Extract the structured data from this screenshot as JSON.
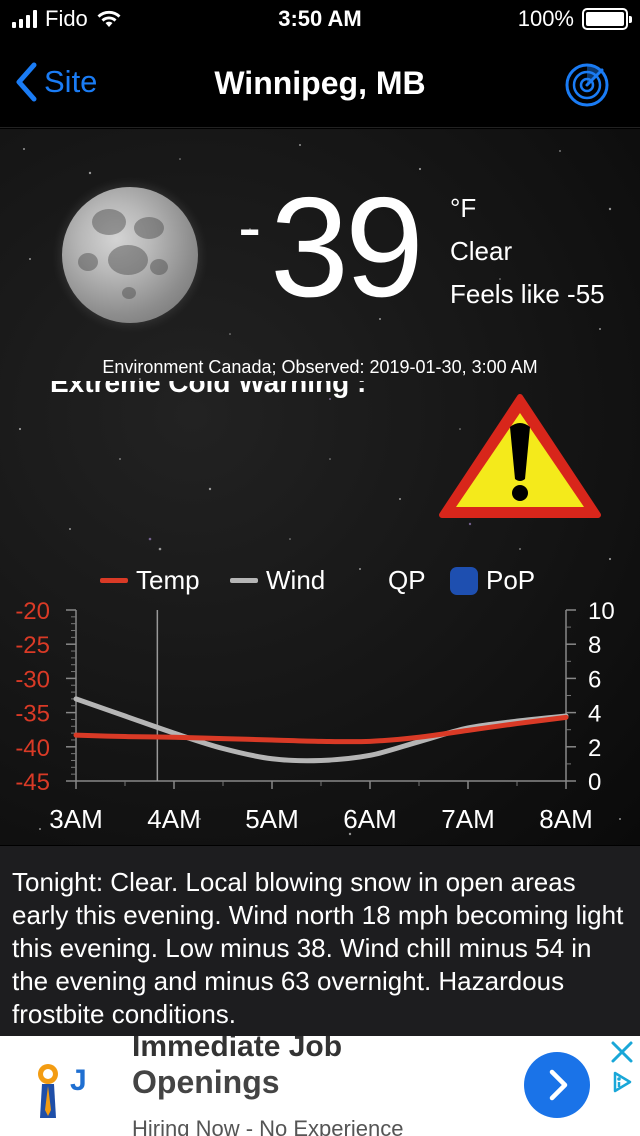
{
  "status_bar": {
    "carrier": "Fido",
    "time": "3:50 AM",
    "battery": "100%"
  },
  "nav": {
    "back_label": "Site",
    "title": "Winnipeg, MB",
    "radar_icon": "radar-icon"
  },
  "current": {
    "minus": "-",
    "temperature": "39",
    "unit": "°F",
    "condition": "Clear",
    "feels_like": "Feels like -55",
    "observed": "Environment Canada; Observed: 2019-01-30, 3:00 AM",
    "warning": "Extreme Cold Warning :"
  },
  "chart_data": {
    "type": "line",
    "legend": [
      "Temp",
      "Wind",
      "QP",
      "PoP"
    ],
    "x": [
      "3AM",
      "4AM",
      "5AM",
      "6AM",
      "7AM",
      "8AM"
    ],
    "x_positions_hours": [
      3,
      4,
      5,
      6,
      7,
      8
    ],
    "series": [
      {
        "name": "Temp",
        "axis": "left",
        "color": "#d93a26",
        "x": [
          3,
          3.5,
          4,
          4.5,
          5,
          5.5,
          6,
          6.5,
          7,
          7.5,
          8
        ],
        "values": [
          -38.3,
          -38.5,
          -38.6,
          -38.8,
          -39.0,
          -39.2,
          -39.2,
          -38.6,
          -37.6,
          -36.6,
          -35.7
        ]
      },
      {
        "name": "Wind",
        "axis": "right",
        "color": "#b5b5b5",
        "x": [
          3,
          3.5,
          4,
          4.5,
          5,
          5.5,
          6,
          6.5,
          7,
          7.5,
          8
        ],
        "values": [
          4.8,
          3.8,
          2.8,
          1.9,
          1.3,
          1.2,
          1.5,
          2.3,
          3.1,
          3.5,
          3.8
        ]
      }
    ],
    "left_axis": {
      "ylim": [
        -45,
        -20
      ],
      "ticks": [
        "-20",
        "-25",
        "-30",
        "-35",
        "-40",
        "-45"
      ],
      "color": "#d93a26"
    },
    "right_axis": {
      "ylim": [
        0,
        10
      ],
      "ticks": [
        "10",
        "8",
        "6",
        "4",
        "2",
        "0"
      ]
    },
    "current_time_marker": 3.83
  },
  "forecast": {
    "text": "Tonight:  Clear. Local blowing snow in open areas early this evening. Wind north 18 mph becoming light this evening. Low minus 38. Wind chill minus 54 in the evening and minus 63 overnight. Hazardous frostbite conditions."
  },
  "ad": {
    "headline_top": "Immediate Job",
    "headline": "Openings",
    "subtext": "Hiring Now - No Experience",
    "accent": "#1a73e8"
  }
}
